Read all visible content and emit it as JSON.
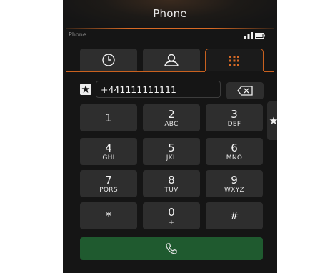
{
  "header": {
    "title": "Phone"
  },
  "status": {
    "label": "Phone"
  },
  "tabs": [
    {
      "name": "recents",
      "icon": "clock-icon",
      "active": false
    },
    {
      "name": "contacts",
      "icon": "person-icon",
      "active": false
    },
    {
      "name": "dialpad",
      "icon": "keypad-icon",
      "active": true
    }
  ],
  "dialer": {
    "number": "+441111111111",
    "favorite_icon": "star-icon",
    "backspace_icon": "backspace-icon"
  },
  "keypad": [
    {
      "digit": "1",
      "letters": ""
    },
    {
      "digit": "2",
      "letters": "ABC"
    },
    {
      "digit": "3",
      "letters": "DEF"
    },
    {
      "digit": "4",
      "letters": "GHI"
    },
    {
      "digit": "5",
      "letters": "JKL"
    },
    {
      "digit": "6",
      "letters": "MNO"
    },
    {
      "digit": "7",
      "letters": "PQRS"
    },
    {
      "digit": "8",
      "letters": "TUV"
    },
    {
      "digit": "9",
      "letters": "WXYZ"
    },
    {
      "digit": "*",
      "letters": ""
    },
    {
      "digit": "0",
      "letters": "+"
    },
    {
      "digit": "#",
      "letters": ""
    }
  ],
  "call_button": {
    "icon": "phone-icon"
  },
  "colors": {
    "accent": "#d76a25",
    "call": "#1f5a2f",
    "key": "#2e2e2e",
    "background": "#151515"
  }
}
